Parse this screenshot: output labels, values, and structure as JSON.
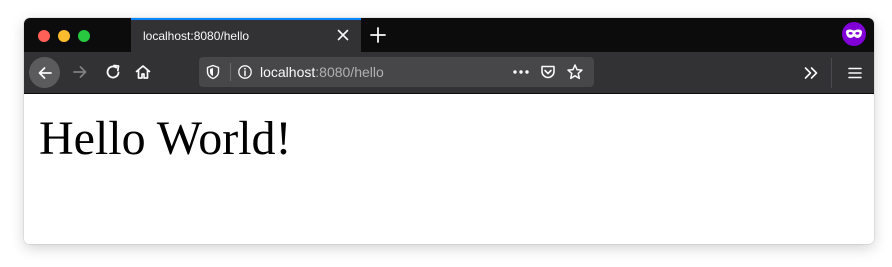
{
  "tab": {
    "title": "localhost:8080/hello"
  },
  "url": {
    "host": "localhost",
    "rest": ":8080/hello"
  },
  "page": {
    "heading": "Hello World!"
  },
  "colors": {
    "tab_accent": "#0a84ff",
    "private_badge": "#8000d7",
    "titlebar": "#0c0c0d",
    "toolbar": "#323234"
  },
  "icons": [
    "close-window",
    "minimize-window",
    "maximize-window",
    "close-tab-icon",
    "new-tab-icon",
    "private-browsing-icon",
    "back-arrow-icon",
    "forward-arrow-icon",
    "reload-icon",
    "home-icon",
    "tracking-protection-shield-icon",
    "site-info-icon",
    "page-actions-icon",
    "pocket-icon",
    "bookmark-star-icon",
    "overflow-chevron-icon",
    "hamburger-menu-icon"
  ]
}
